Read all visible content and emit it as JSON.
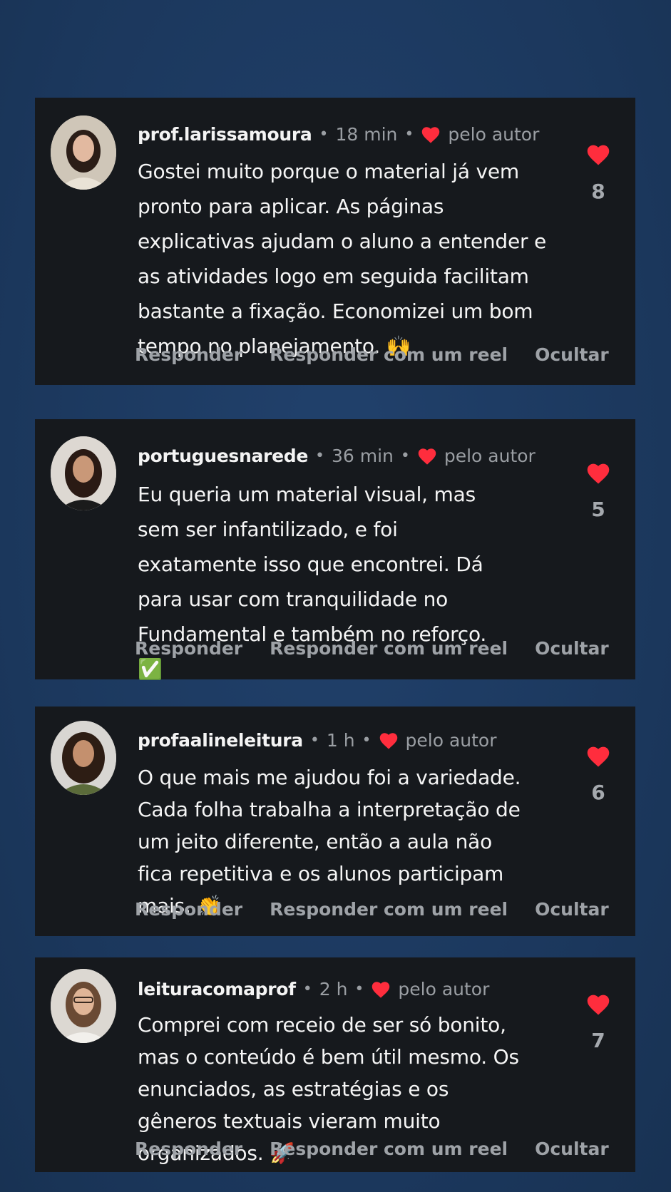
{
  "comments": [
    {
      "username": "prof.larissamoura",
      "time": "18 min",
      "author_label": "pelo autor",
      "text": "Gostei muito porque o material já vem pronto para aplicar. As páginas explicativas ajudam o aluno a entender e as atividades logo em seguida facilitam bastante a fixação. Economizei um bom tempo no planejamento.",
      "emoji": "🙌",
      "likes": "8",
      "actions": {
        "reply": "Responder",
        "reply_reel": "Responder com um reel",
        "hide": "Ocultar"
      }
    },
    {
      "username": "portuguesnarede",
      "time": "36 min",
      "author_label": "pelo autor",
      "text": "Eu queria um material visual, mas sem ser infantilizado, e foi exatamente isso que encontrei. Dá para usar com tranquilidade no Fundamental e também no reforço.",
      "emoji": "✅",
      "likes": "5",
      "actions": {
        "reply": "Responder",
        "reply_reel": "Responder com um reel",
        "hide": "Ocultar"
      }
    },
    {
      "username": "profaalineleitura",
      "time": "1 h",
      "author_label": "pelo autor",
      "text": "O que mais me ajudou foi a variedade. Cada folha trabalha a interpretação de um jeito diferente, então a aula não fica repetitiva e os alunos participam mais.",
      "emoji": "👏",
      "likes": "6",
      "actions": {
        "reply": "Responder",
        "reply_reel": "Responder com um reel",
        "hide": "Ocultar"
      }
    },
    {
      "username": "leituracomaprof",
      "time": "2 h",
      "author_label": "pelo autor",
      "text": "Comprei com receio de ser só bonito, mas o conteúdo é bem útil mesmo. Os enunciados, as estratégias e os gêneros textuais vieram muito organizados.",
      "emoji": "🚀",
      "likes": "7",
      "actions": {
        "reply": "Responder",
        "reply_reel": "Responder com um reel",
        "hide": "Ocultar"
      }
    }
  ],
  "colors": {
    "background": "#1d3b63",
    "card": "#16191d",
    "heart": "#ff2d3d",
    "muted": "#9a9ea3"
  },
  "icons": {
    "like": "heart-icon",
    "author_like": "heart-icon",
    "avatar": "avatar-photo"
  }
}
